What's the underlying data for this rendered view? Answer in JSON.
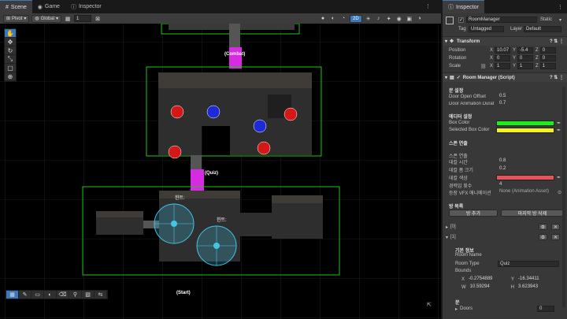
{
  "tabs": {
    "scene": "Scene",
    "game": "Game",
    "inspector_tab": "Inspector"
  },
  "toolbar": {
    "pivot": "Pivot",
    "global": "Global",
    "snap_value": "1",
    "mode_2d": "2D"
  },
  "scene": {
    "labels": {
      "combat": "(Combat)",
      "quiz": "(Quiz)",
      "start": "(Start)",
      "hint1": "힌트:",
      "hint2": "힌트:"
    },
    "colors": {
      "room_box": "#22c01e",
      "door": "#d62be0",
      "enemy_red": "#d41818",
      "enemy_blue": "#1d2ad8",
      "hint_circle": "#45c5e6",
      "grid": "#3a3a3a"
    }
  },
  "inspector": {
    "title": "Inspector",
    "object": {
      "name": "RoomManager",
      "static_label": "Static",
      "tag_label": "Tag",
      "tag_value": "Untagged",
      "layer_label": "Layer",
      "layer_value": "Default"
    },
    "transform": {
      "header": "Transform",
      "position_label": "Position",
      "rotation_label": "Rotation",
      "scale_label": "Scale",
      "position": {
        "x": "10.07",
        "y": "-5.4",
        "z": "0"
      },
      "rotation": {
        "x": "0",
        "y": "0",
        "z": "0"
      },
      "scale": {
        "x": "1",
        "y": "1",
        "z": "1"
      }
    },
    "script": {
      "header": "Room Manager (Script)",
      "door_section": "문 설정",
      "door_open_offset_label": "Door Open Offset",
      "door_open_offset_value": "0.5",
      "door_anim_label": "Door Animation Durat",
      "door_anim_value": "0.7",
      "editor_section": "에디터 설정",
      "box_color_label": "Box Color",
      "box_color": "#19f21a",
      "selected_box_color_label": "Selected Box Color",
      "selected_box_color": "#f5f21a",
      "spawn_section": "스폰 연출",
      "spawn_sub": "스폰 연출",
      "decal_time_label": "데칼 시간",
      "decal_time_value": "0.8",
      "decal_size_label": "데칼 폼 크기",
      "decal_size_value": "0.2",
      "decal_color_label": "데칼 색상",
      "decal_color": "#e5545a",
      "warning_count_label": "경력임 횟수",
      "warning_count_value": "4",
      "vfx_label": "등장 VFX 애니메이션",
      "vfx_value": "None (Animation Asset)",
      "rooms_section": "방 목록",
      "add_room_button": "방 추가",
      "delete_room_button": "마지막 방 삭제",
      "list": [
        {
          "label": "[0]"
        },
        {
          "label": "[1]"
        }
      ],
      "basic_info": "기본 정보",
      "room_name_label": "Room Name",
      "room_type_label": "Room Type",
      "room_type_value": "Quiz",
      "bounds_label": "Bounds",
      "bounds": {
        "x": "-0.2754889",
        "y": "-16.34411",
        "w": "10.59294",
        "h": "3.623943"
      },
      "door_section_2": "문",
      "doors_label": "Doors",
      "doors_count": "0"
    }
  }
}
